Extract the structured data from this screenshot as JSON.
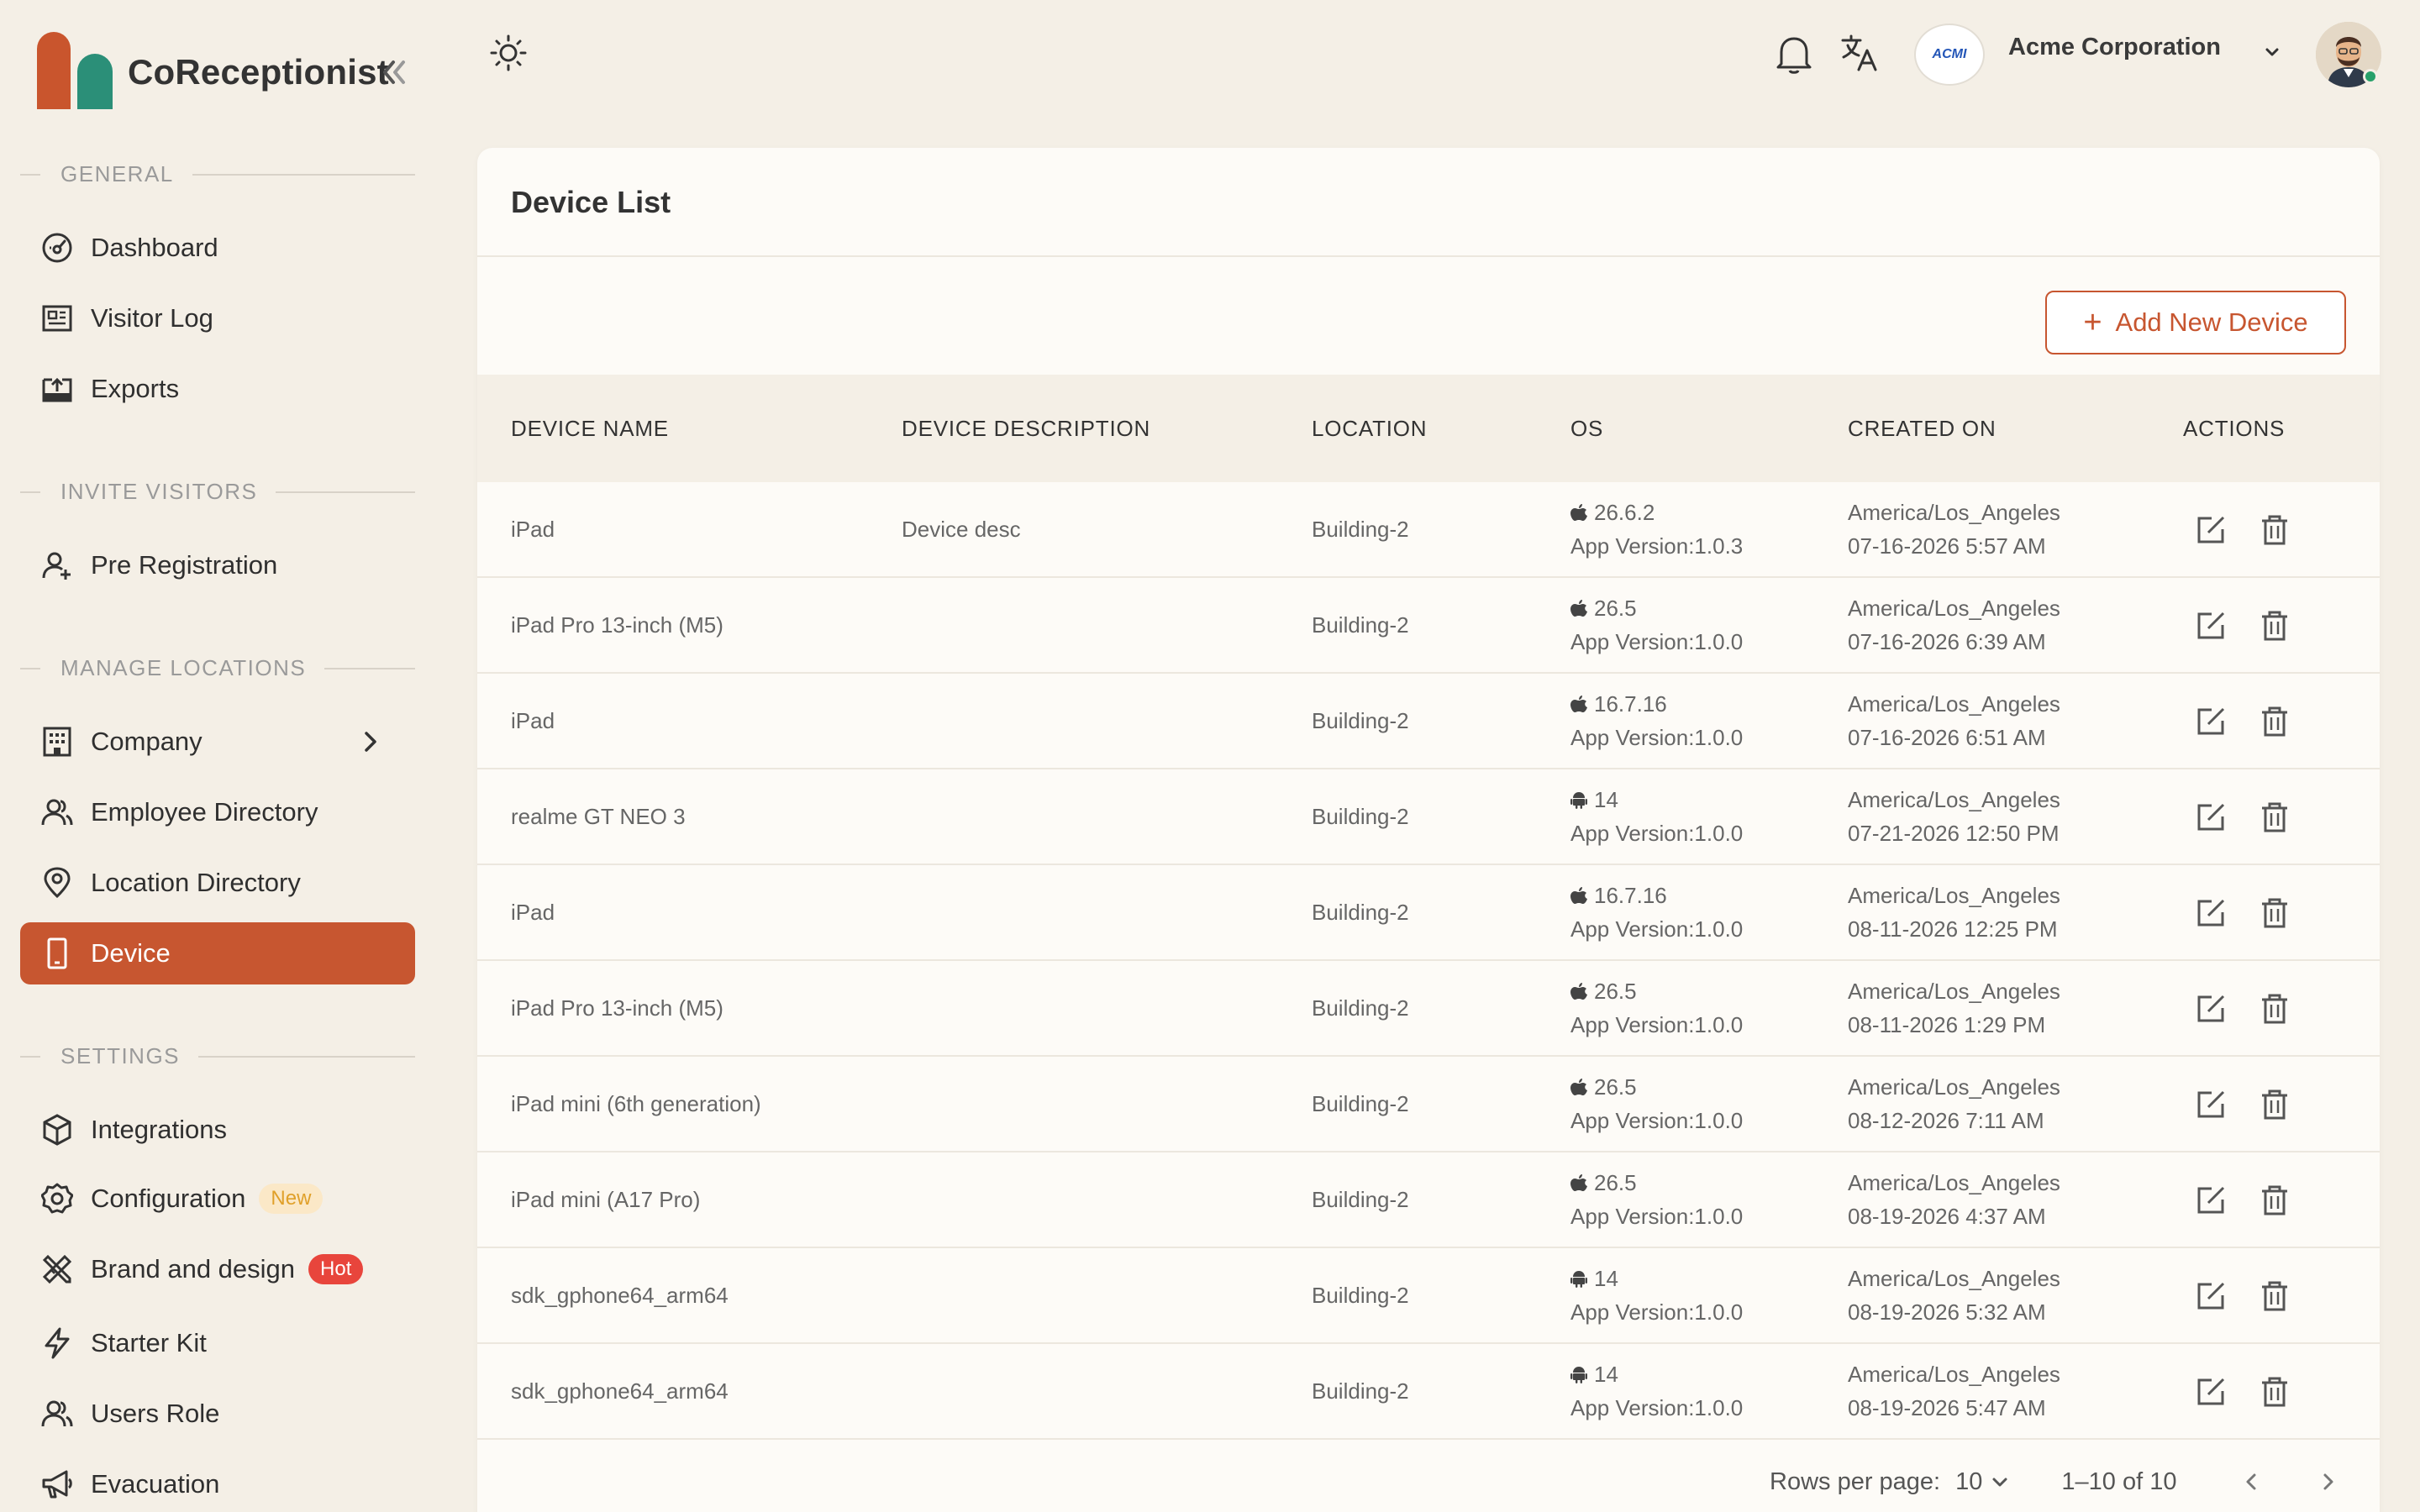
{
  "app": {
    "name": "CoReceptionist"
  },
  "sidebar": {
    "sections": [
      {
        "label": "GENERAL"
      },
      {
        "label": "INVITE VISITORS"
      },
      {
        "label": "MANAGE LOCATIONS"
      },
      {
        "label": "SETTINGS"
      }
    ],
    "items": [
      {
        "label": "Dashboard",
        "icon": "dashboard-gauge-icon"
      },
      {
        "label": "Visitor Log",
        "icon": "newspaper-icon"
      },
      {
        "label": "Exports",
        "icon": "export-icon"
      },
      {
        "label": "Pre Registration",
        "icon": "user-plus-icon"
      },
      {
        "label": "Company",
        "icon": "building-icon"
      },
      {
        "label": "Employee Directory",
        "icon": "users-icon"
      },
      {
        "label": "Location Directory",
        "icon": "map-pin-icon"
      },
      {
        "label": "Device",
        "icon": "tablet-icon",
        "active": true
      },
      {
        "label": "Integrations",
        "icon": "hexagon-icon"
      },
      {
        "label": "Configuration",
        "icon": "gear-icon",
        "badge": "New"
      },
      {
        "label": "Brand and design",
        "icon": "ruler-pencil-icon",
        "badge": "Hot"
      },
      {
        "label": "Starter Kit",
        "icon": "lightning-icon"
      },
      {
        "label": "Users Role",
        "icon": "users-icon"
      },
      {
        "label": "Evacuation",
        "icon": "megaphone-icon"
      }
    ]
  },
  "topbar": {
    "org_logo_text": "ACMI",
    "org_name": "Acme Corporation"
  },
  "page": {
    "title": "Device List",
    "add_button_label": "Add New Device"
  },
  "table": {
    "columns": [
      "DEVICE NAME",
      "DEVICE DESCRIPTION",
      "LOCATION",
      "OS",
      "CREATED ON",
      "ACTIONS"
    ],
    "rows": [
      {
        "name": "iPad",
        "description": "Device desc",
        "location": "Building-2",
        "os_type": "apple",
        "os_version": "26.6.2",
        "app_version": "App Version:1.0.3",
        "timezone": "America/Los_Angeles",
        "created": "07-16-2026 5:57 AM"
      },
      {
        "name": "iPad Pro 13-inch (M5)",
        "description": "",
        "location": "Building-2",
        "os_type": "apple",
        "os_version": "26.5",
        "app_version": "App Version:1.0.0",
        "timezone": "America/Los_Angeles",
        "created": "07-16-2026 6:39 AM"
      },
      {
        "name": "iPad",
        "description": "",
        "location": "Building-2",
        "os_type": "apple",
        "os_version": "16.7.16",
        "app_version": "App Version:1.0.0",
        "timezone": "America/Los_Angeles",
        "created": "07-16-2026 6:51 AM"
      },
      {
        "name": "realme GT NEO 3",
        "description": "",
        "location": "Building-2",
        "os_type": "android",
        "os_version": "14",
        "app_version": "App Version:1.0.0",
        "timezone": "America/Los_Angeles",
        "created": "07-21-2026 12:50 PM"
      },
      {
        "name": "iPad",
        "description": "",
        "location": "Building-2",
        "os_type": "apple",
        "os_version": "16.7.16",
        "app_version": "App Version:1.0.0",
        "timezone": "America/Los_Angeles",
        "created": "08-11-2026 12:25 PM"
      },
      {
        "name": "iPad Pro 13-inch (M5)",
        "description": "",
        "location": "Building-2",
        "os_type": "apple",
        "os_version": "26.5",
        "app_version": "App Version:1.0.0",
        "timezone": "America/Los_Angeles",
        "created": "08-11-2026 1:29 PM"
      },
      {
        "name": "iPad mini (6th generation)",
        "description": "",
        "location": "Building-2",
        "os_type": "apple",
        "os_version": "26.5",
        "app_version": "App Version:1.0.0",
        "timezone": "America/Los_Angeles",
        "created": "08-12-2026 7:11 AM"
      },
      {
        "name": "iPad mini (A17 Pro)",
        "description": "",
        "location": "Building-2",
        "os_type": "apple",
        "os_version": "26.5",
        "app_version": "App Version:1.0.0",
        "timezone": "America/Los_Angeles",
        "created": "08-19-2026 4:37 AM"
      },
      {
        "name": "sdk_gphone64_arm64",
        "description": "",
        "location": "Building-2",
        "os_type": "android",
        "os_version": "14",
        "app_version": "App Version:1.0.0",
        "timezone": "America/Los_Angeles",
        "created": "08-19-2026 5:32 AM"
      },
      {
        "name": "sdk_gphone64_arm64",
        "description": "",
        "location": "Building-2",
        "os_type": "android",
        "os_version": "14",
        "app_version": "App Version:1.0.0",
        "timezone": "America/Los_Angeles",
        "created": "08-19-2026 5:47 AM"
      }
    ]
  },
  "pagination": {
    "rows_per_page_label": "Rows per page:",
    "rows_per_page_value": "10",
    "range": "1–10 of 10"
  },
  "colors": {
    "accent": "#c75630",
    "brand_orange": "#c9552d",
    "brand_green": "#2b8f78",
    "background": "#f4efe6",
    "online": "#27a06a"
  }
}
